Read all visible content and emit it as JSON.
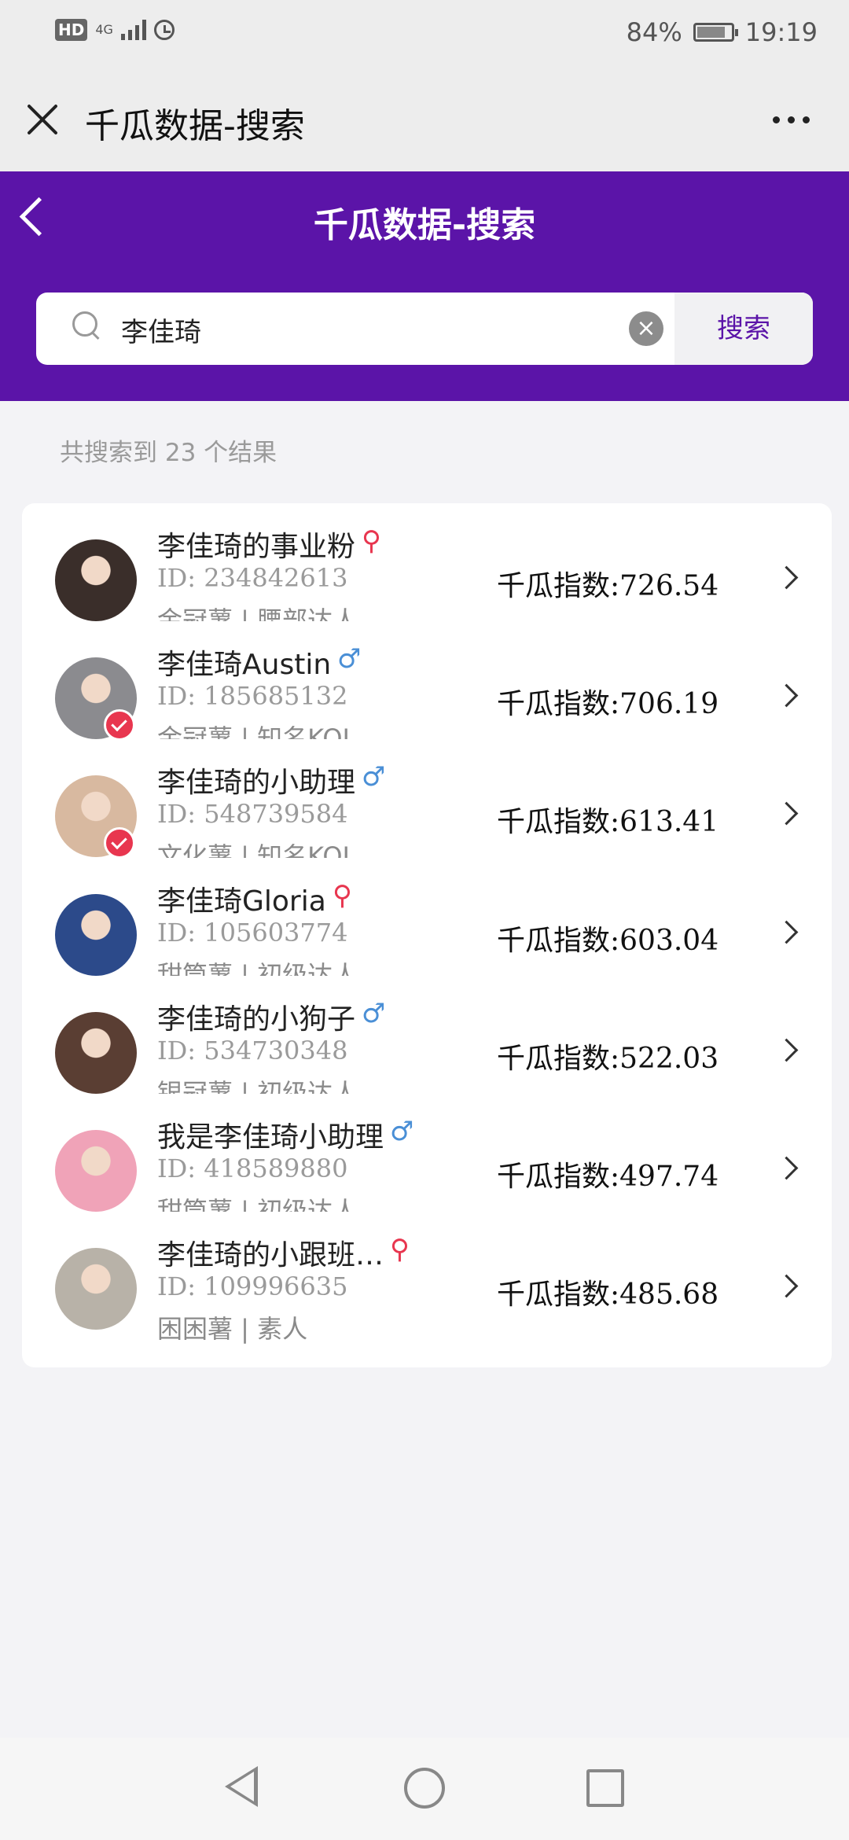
{
  "status_bar": {
    "hd": "HD",
    "network": "4G",
    "battery_percent": "84%",
    "time": "19:19",
    "battery_level": 0.84
  },
  "wechat_bar": {
    "title": "千瓜数据-搜索",
    "close_icon": "close-icon",
    "more_icon": "more-icon"
  },
  "header": {
    "title": "千瓜数据-搜索",
    "back_icon": "back-chevron-icon",
    "color": "#5b14a8"
  },
  "search": {
    "value": "李佳琦",
    "button_label": "搜索",
    "clear_icon": "clear-icon"
  },
  "results": {
    "summary": "共搜索到 23 个结果",
    "items": [
      {
        "name": "李佳琦的事业粉",
        "gender": "female",
        "gender_symbol": "⚲",
        "id": "ID: 234842613",
        "tags": "金冠薯 | 腰部达人",
        "index": "千瓜指数:726.54",
        "verified": false,
        "avatar_color": "#3a2e2a"
      },
      {
        "name": "李佳琦Austin",
        "gender": "male",
        "gender_symbol": "♂",
        "id": "ID: 185685132",
        "tags": "金冠薯 | 知名KOL",
        "index": "千瓜指数:706.19",
        "verified": true,
        "avatar_color": "#8b8b8f"
      },
      {
        "name": "李佳琦的小助理",
        "gender": "male",
        "gender_symbol": "♂",
        "id": "ID: 548739584",
        "tags": "文化薯 | 知名KOL",
        "index": "千瓜指数:613.41",
        "verified": true,
        "avatar_color": "#d8b9a0"
      },
      {
        "name": "李佳琦Gloria",
        "gender": "female",
        "gender_symbol": "⚲",
        "id": "ID: 105603774",
        "tags": "甜筒薯 | 初级达人",
        "index": "千瓜指数:603.04",
        "verified": false,
        "avatar_color": "#2c4a8a"
      },
      {
        "name": "李佳琦的小狗子",
        "gender": "male",
        "gender_symbol": "♂",
        "id": "ID: 534730348",
        "tags": "银冠薯 | 初级达人",
        "index": "千瓜指数:522.03",
        "verified": false,
        "avatar_color": "#5a3e33"
      },
      {
        "name": "我是李佳琦小助理",
        "gender": "male",
        "gender_symbol": "♂",
        "id": "ID: 418589880",
        "tags": "甜筒薯 | 初级达人",
        "index": "千瓜指数:497.74",
        "verified": false,
        "avatar_color": "#f0a3b8"
      },
      {
        "name": "李佳琦的小跟班…",
        "gender": "female",
        "gender_symbol": "⚲",
        "id": "ID: 109996635",
        "tags": "困困薯 | 素人",
        "index": "千瓜指数:485.68",
        "verified": false,
        "avatar_color": "#b8b2a8"
      }
    ]
  },
  "nav": {
    "back_icon": "nav-back-icon",
    "home_icon": "nav-home-icon",
    "recents_icon": "nav-recents-icon"
  }
}
